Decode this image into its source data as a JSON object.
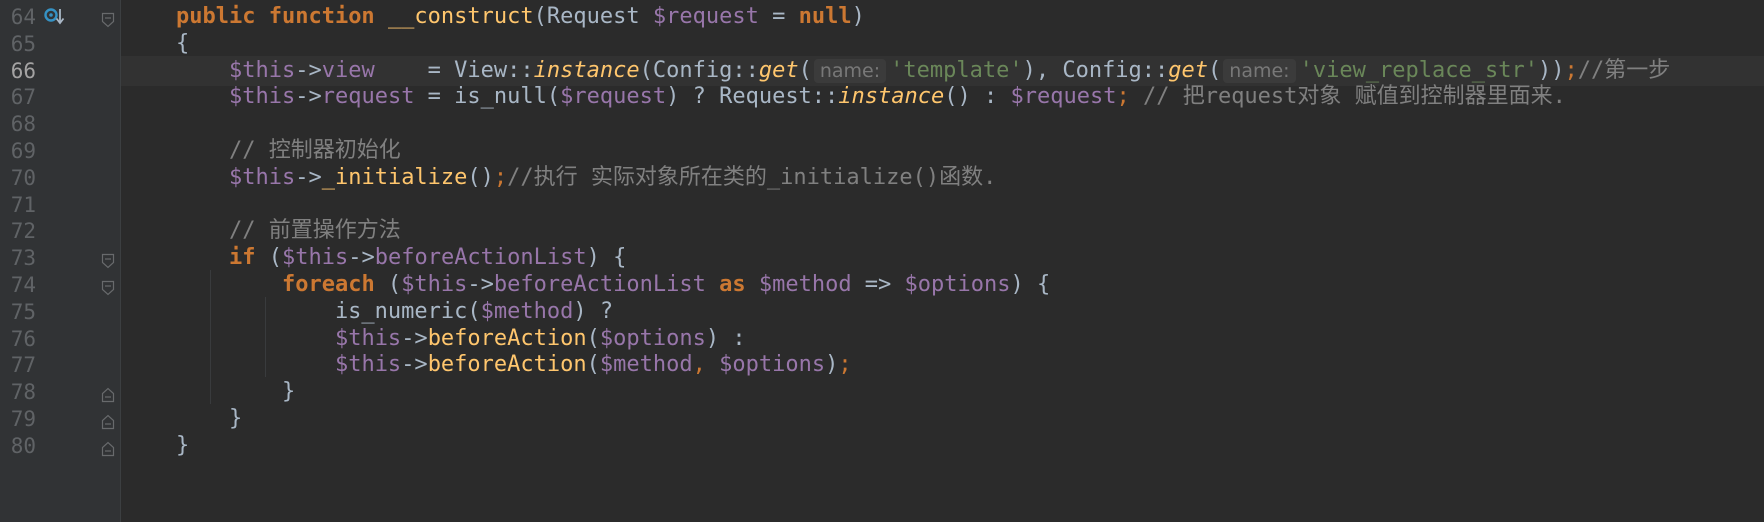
{
  "editor": {
    "current_line": 66,
    "lines": [
      {
        "no": "64",
        "tokens": [
          {
            "t": "public ",
            "c": "kw"
          },
          {
            "t": "function ",
            "c": "kw"
          },
          {
            "t": "__construct",
            "c": "fn"
          },
          {
            "t": "(Request ",
            "c": "plain"
          },
          {
            "t": "$request",
            "c": "var"
          },
          {
            "t": " = ",
            "c": "plain"
          },
          {
            "t": "null",
            "c": "kw"
          },
          {
            "t": ")",
            "c": "plain"
          }
        ]
      },
      {
        "no": "65",
        "tokens": [
          {
            "t": "{",
            "c": "plain"
          }
        ]
      },
      {
        "no": "66",
        "tokens": [
          {
            "t": "    ",
            "c": "plain"
          },
          {
            "t": "$this",
            "c": "var"
          },
          {
            "t": "->",
            "c": "plain"
          },
          {
            "t": "view",
            "c": "var"
          },
          {
            "t": "    = View::",
            "c": "plain"
          },
          {
            "t": "instance",
            "c": "it"
          },
          {
            "t": "(Config::",
            "c": "plain"
          },
          {
            "t": "get",
            "c": "it"
          },
          {
            "t": "(",
            "c": "plain"
          },
          {
            "t": "name:",
            "c": "hint"
          },
          {
            "t": "'template'",
            "c": "str"
          },
          {
            "t": "), Config::",
            "c": "plain"
          },
          {
            "t": "get",
            "c": "it"
          },
          {
            "t": "(",
            "c": "plain"
          },
          {
            "t": "name:",
            "c": "hint"
          },
          {
            "t": "'view_replace_str'",
            "c": "str"
          },
          {
            "t": "))",
            "c": "plain"
          },
          {
            "t": ";",
            "c": "semi"
          },
          {
            "t": "//第一步",
            "c": "cmt"
          }
        ]
      },
      {
        "no": "67",
        "tokens": [
          {
            "t": "    ",
            "c": "plain"
          },
          {
            "t": "$this",
            "c": "var"
          },
          {
            "t": "->",
            "c": "plain"
          },
          {
            "t": "request",
            "c": "var"
          },
          {
            "t": " = is_null(",
            "c": "plain"
          },
          {
            "t": "$request",
            "c": "var"
          },
          {
            "t": ") ? Request::",
            "c": "plain"
          },
          {
            "t": "instance",
            "c": "it"
          },
          {
            "t": "() : ",
            "c": "plain"
          },
          {
            "t": "$request",
            "c": "var"
          },
          {
            "t": ";",
            "c": "semi"
          },
          {
            "t": " // 把request对象 赋值到控制器里面来.",
            "c": "cmt"
          }
        ]
      },
      {
        "no": "68",
        "tokens": []
      },
      {
        "no": "69",
        "tokens": [
          {
            "t": "    ",
            "c": "plain"
          },
          {
            "t": "// 控制器初始化",
            "c": "cmt"
          }
        ]
      },
      {
        "no": "70",
        "tokens": [
          {
            "t": "    ",
            "c": "plain"
          },
          {
            "t": "$this",
            "c": "var"
          },
          {
            "t": "->",
            "c": "plain"
          },
          {
            "t": "_initialize",
            "c": "fn"
          },
          {
            "t": "()",
            "c": "plain"
          },
          {
            "t": ";",
            "c": "semi"
          },
          {
            "t": "//执行 实际对象所在类的_initialize()函数.",
            "c": "cmt"
          }
        ]
      },
      {
        "no": "71",
        "tokens": []
      },
      {
        "no": "72",
        "tokens": [
          {
            "t": "    ",
            "c": "plain"
          },
          {
            "t": "// 前置操作方法",
            "c": "cmt"
          }
        ]
      },
      {
        "no": "73",
        "tokens": [
          {
            "t": "    ",
            "c": "plain"
          },
          {
            "t": "if",
            "c": "kw"
          },
          {
            "t": " (",
            "c": "plain"
          },
          {
            "t": "$this",
            "c": "var"
          },
          {
            "t": "->",
            "c": "plain"
          },
          {
            "t": "beforeActionList",
            "c": "var"
          },
          {
            "t": ") {",
            "c": "plain"
          }
        ]
      },
      {
        "no": "74",
        "tokens": [
          {
            "t": "        ",
            "c": "plain"
          },
          {
            "t": "foreach",
            "c": "kw"
          },
          {
            "t": " (",
            "c": "plain"
          },
          {
            "t": "$this",
            "c": "var"
          },
          {
            "t": "->",
            "c": "plain"
          },
          {
            "t": "beforeActionList",
            "c": "var"
          },
          {
            "t": " ",
            "c": "plain"
          },
          {
            "t": "as",
            "c": "kw"
          },
          {
            "t": " ",
            "c": "plain"
          },
          {
            "t": "$method",
            "c": "var"
          },
          {
            "t": " => ",
            "c": "plain"
          },
          {
            "t": "$options",
            "c": "var"
          },
          {
            "t": ") {",
            "c": "plain"
          }
        ]
      },
      {
        "no": "75",
        "tokens": [
          {
            "t": "            is_numeric(",
            "c": "plain"
          },
          {
            "t": "$method",
            "c": "var"
          },
          {
            "t": ") ?",
            "c": "plain"
          }
        ]
      },
      {
        "no": "76",
        "tokens": [
          {
            "t": "            ",
            "c": "plain"
          },
          {
            "t": "$this",
            "c": "var"
          },
          {
            "t": "->",
            "c": "plain"
          },
          {
            "t": "beforeAction",
            "c": "fn"
          },
          {
            "t": "(",
            "c": "plain"
          },
          {
            "t": "$options",
            "c": "var"
          },
          {
            "t": ") :",
            "c": "plain"
          }
        ]
      },
      {
        "no": "77",
        "tokens": [
          {
            "t": "            ",
            "c": "plain"
          },
          {
            "t": "$this",
            "c": "var"
          },
          {
            "t": "->",
            "c": "plain"
          },
          {
            "t": "beforeAction",
            "c": "fn"
          },
          {
            "t": "(",
            "c": "plain"
          },
          {
            "t": "$method",
            "c": "var"
          },
          {
            "t": ", ",
            "c": "semi"
          },
          {
            "t": "$options",
            "c": "var"
          },
          {
            "t": ")",
            "c": "plain"
          },
          {
            "t": ";",
            "c": "semi"
          }
        ]
      },
      {
        "no": "78",
        "tokens": [
          {
            "t": "        }",
            "c": "plain"
          }
        ]
      },
      {
        "no": "79",
        "tokens": [
          {
            "t": "    }",
            "c": "plain"
          }
        ]
      },
      {
        "no": "80",
        "tokens": [
          {
            "t": "}",
            "c": "plain"
          }
        ]
      }
    ],
    "fold_markers": {
      "64": "open",
      "73": "open",
      "74": "open",
      "78": "close",
      "79": "close",
      "80": "close"
    },
    "gutter_icons": {
      "64": "override-method-icon"
    },
    "colors": {
      "background": "#2b2b2b",
      "gutter": "#313335",
      "keyword": "#cc7832",
      "function": "#ffc66d",
      "variable": "#9876aa",
      "string": "#6a8759",
      "comment": "#808080",
      "text": "#a9b7c6"
    }
  }
}
